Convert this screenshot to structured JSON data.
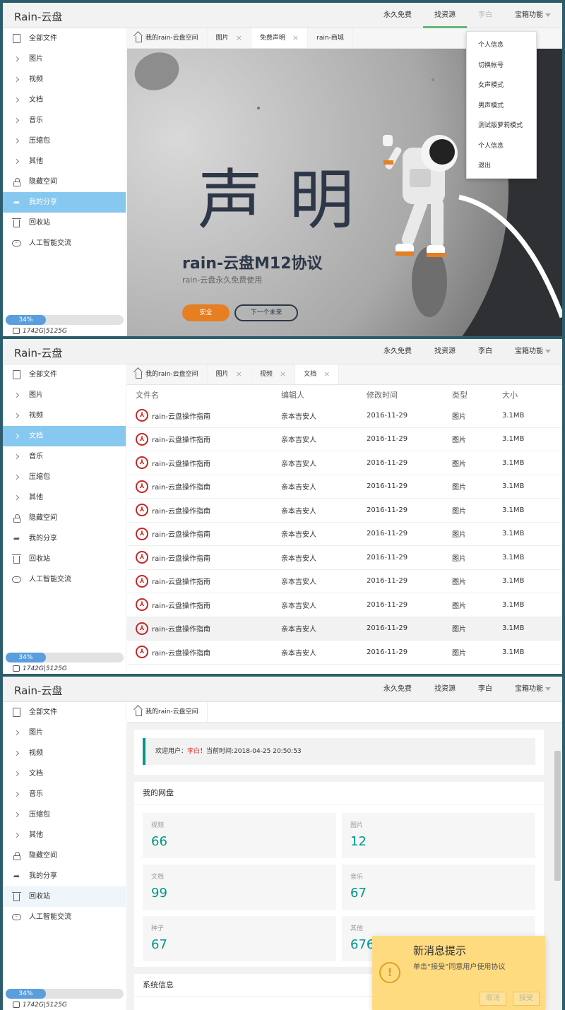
{
  "app": {
    "title": "Rain-云盘"
  },
  "nav": {
    "free": "永久免费",
    "find": "找资源",
    "user": "李白",
    "more": "宝箱功能"
  },
  "sidebar": {
    "items": [
      "全部文件",
      "图片",
      "视频",
      "文档",
      "音乐",
      "压缩包",
      "其他",
      "隐藏空间",
      "我的分享",
      "回收站",
      "人工智能交流"
    ]
  },
  "storage": {
    "percent_label": "34%",
    "percent": 0.34,
    "usage": "1742G|5125G"
  },
  "panel1": {
    "tabs": [
      "我的rain-云盘空间",
      "图片",
      "免费声明",
      "rain-商城"
    ],
    "dropdown": [
      "个人信息",
      "切换帐号",
      "女声模式",
      "男声模式",
      "测试版萝莉模式",
      "个人信息",
      "退出"
    ],
    "banner": {
      "heading": "声 明",
      "line1": "rain-云盘M12协议",
      "line2": "rain-云盘永久免费使用",
      "accept": "安全",
      "next": "下一个未来"
    }
  },
  "panel2": {
    "tabs": [
      "我的rain-云盘空间",
      "图片",
      "视频",
      "文档"
    ],
    "headers": [
      "文件名",
      "编辑人",
      "修改时间",
      "类型",
      "大小"
    ],
    "rows": [
      [
        "rain-云盘操作指南",
        "亲本吉安人",
        "2016-11-29",
        "图片",
        "3.1MB"
      ],
      [
        "rain-云盘操作指南",
        "亲本吉安人",
        "2016-11-29",
        "图片",
        "3.1MB"
      ],
      [
        "rain-云盘操作指南",
        "亲本吉安人",
        "2016-11-29",
        "图片",
        "3.1MB"
      ],
      [
        "rain-云盘操作指南",
        "亲本吉安人",
        "2016-11-29",
        "图片",
        "3.1MB"
      ],
      [
        "rain-云盘操作指南",
        "亲本吉安人",
        "2016-11-29",
        "图片",
        "3.1MB"
      ],
      [
        "rain-云盘操作指南",
        "亲本吉安人",
        "2016-11-29",
        "图片",
        "3.1MB"
      ],
      [
        "rain-云盘操作指南",
        "亲本吉安人",
        "2016-11-29",
        "图片",
        "3.1MB"
      ],
      [
        "rain-云盘操作指南",
        "亲本吉安人",
        "2016-11-29",
        "图片",
        "3.1MB"
      ],
      [
        "rain-云盘操作指南",
        "亲本吉安人",
        "2016-11-29",
        "图片",
        "3.1MB"
      ],
      [
        "rain-云盘操作指南",
        "亲本吉安人",
        "2016-11-29",
        "图片",
        "3.1MB"
      ],
      [
        "rain-云盘操作指南",
        "亲本吉安人",
        "2016-11-29",
        "图片",
        "3.1MB"
      ]
    ]
  },
  "panel3": {
    "tab": "我的rain-云盘空间",
    "welcome": {
      "prefix": "欢迎用户：",
      "user": "李白",
      "suffix": "！当前时间:2018-04-25 20:50:53"
    },
    "disk_title": "我的网盘",
    "stats": [
      {
        "label": "视频",
        "value": "66"
      },
      {
        "label": "图片",
        "value": "12"
      },
      {
        "label": "文档",
        "value": "99"
      },
      {
        "label": "音乐",
        "value": "67"
      },
      {
        "label": "种子",
        "value": "67"
      },
      {
        "label": "其他",
        "value": "676"
      }
    ],
    "sys_title": "系统信息",
    "toast": {
      "title": "新消息提示",
      "message": "单击“接受”同意用户使用协议",
      "cancel": "取消",
      "accept": "接受"
    }
  },
  "colors": {
    "accent": "#5fb878",
    "selected": "#87c8f0",
    "teal": "#009688",
    "toast": "#ffdb80",
    "progress": "#5a9ede"
  }
}
